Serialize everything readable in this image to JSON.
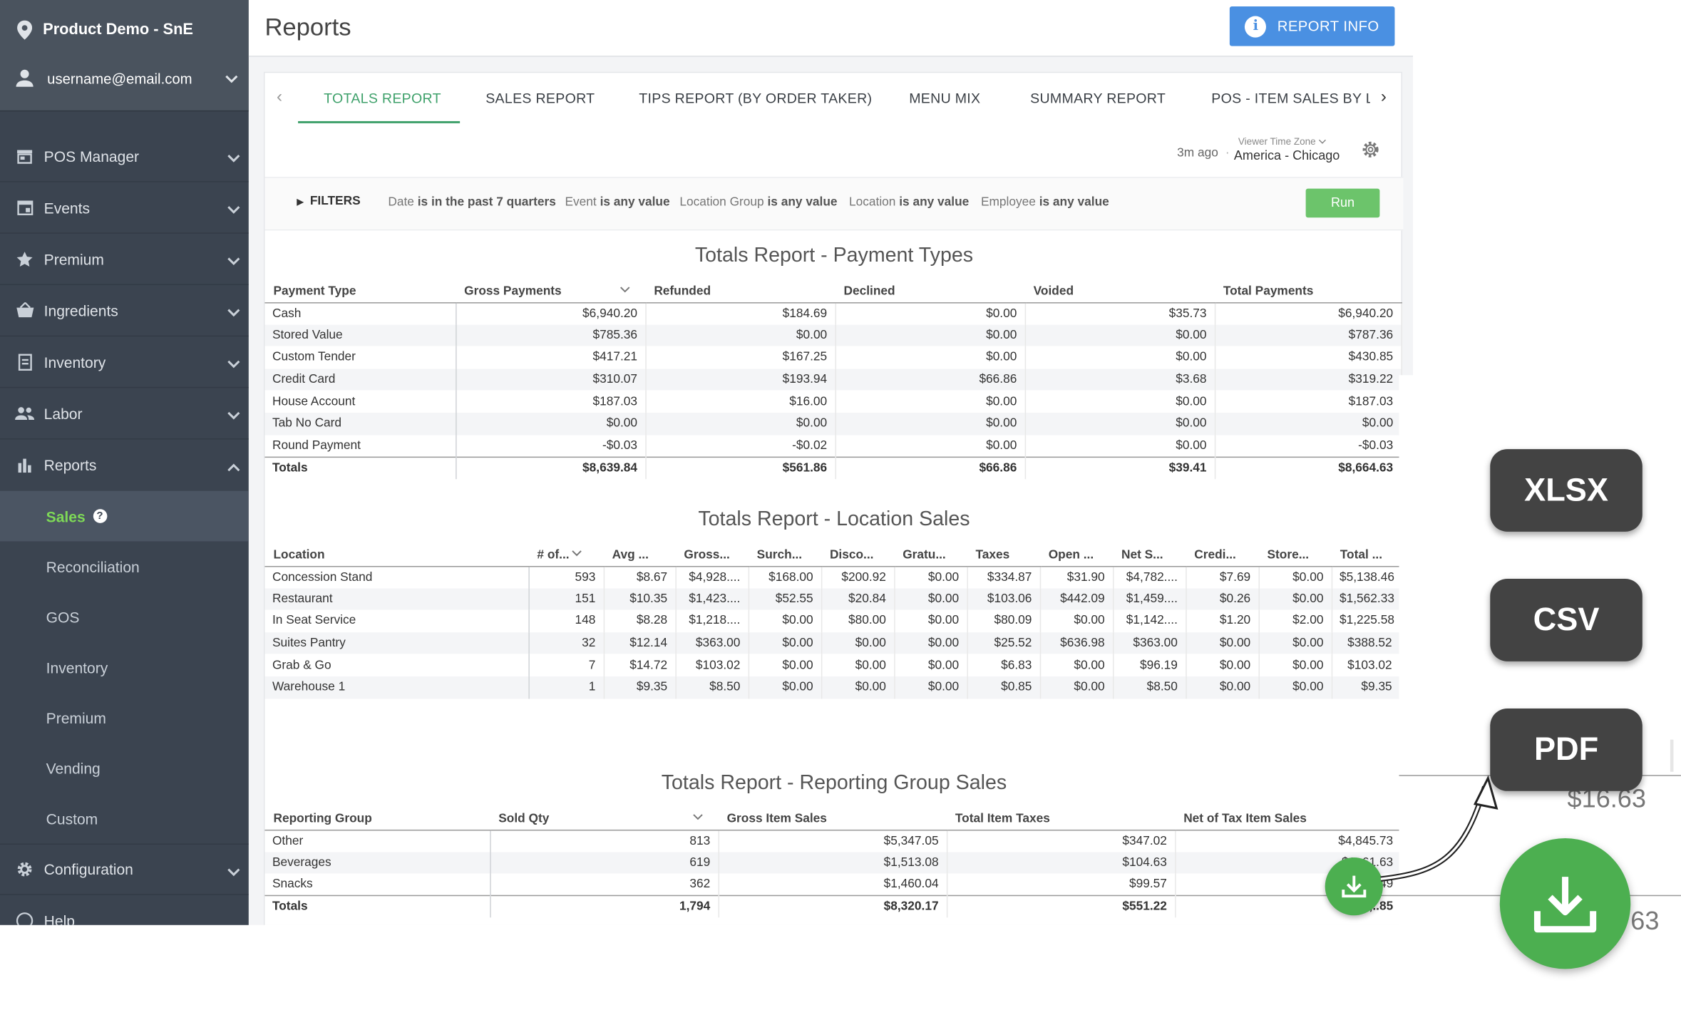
{
  "sidebar": {
    "brand": "Product Demo - SnE",
    "user": "username@email.com",
    "items": [
      {
        "label": "POS Manager"
      },
      {
        "label": "Events"
      },
      {
        "label": "Premium"
      },
      {
        "label": "Ingredients"
      },
      {
        "label": "Inventory"
      },
      {
        "label": "Labor"
      },
      {
        "label": "Reports"
      }
    ],
    "reports_sub": [
      "Sales",
      "Reconciliation",
      "GOS",
      "Inventory",
      "Premium",
      "Vending",
      "Custom"
    ],
    "configuration": "Configuration",
    "help": "Help"
  },
  "header": {
    "title": "Reports",
    "info_button": "REPORT INFO"
  },
  "tabs": [
    "TOTALS REPORT",
    "SALES REPORT",
    "TIPS REPORT (BY ORDER TAKER)",
    "MENU MIX",
    "SUMMARY REPORT",
    "POS - ITEM SALES BY L("
  ],
  "meta": {
    "updated": "3m ago",
    "separator": "·",
    "timezone_label": "Viewer Time Zone",
    "timezone": "America - Chicago"
  },
  "filters": {
    "toggle": "FILTERS",
    "items": [
      {
        "field": "Date",
        "cond": "is in the past 7 quarters"
      },
      {
        "field": "Event",
        "cond": "is any value"
      },
      {
        "field": "Location Group",
        "cond": "is any value"
      },
      {
        "field": "Location",
        "cond": "is any value"
      },
      {
        "field": "Employee",
        "cond": "is any value"
      }
    ],
    "run": "Run"
  },
  "payment_types": {
    "title": "Totals Report - Payment Types",
    "headers": [
      "Payment Type",
      "Gross Payments",
      "Refunded",
      "Declined",
      "Voided",
      "Total Payments"
    ],
    "rows": [
      [
        "Cash",
        "$6,940.20",
        "$184.69",
        "$0.00",
        "$35.73",
        "$6,940.20"
      ],
      [
        "Stored Value",
        "$785.36",
        "$0.00",
        "$0.00",
        "$0.00",
        "$787.36"
      ],
      [
        "Custom Tender",
        "$417.21",
        "$167.25",
        "$0.00",
        "$0.00",
        "$430.85"
      ],
      [
        "Credit Card",
        "$310.07",
        "$193.94",
        "$66.86",
        "$3.68",
        "$319.22"
      ],
      [
        "House Account",
        "$187.03",
        "$16.00",
        "$0.00",
        "$0.00",
        "$187.03"
      ],
      [
        "Tab No Card",
        "$0.00",
        "$0.00",
        "$0.00",
        "$0.00",
        "$0.00"
      ],
      [
        "Round Payment",
        "-$0.03",
        "-$0.02",
        "$0.00",
        "$0.00",
        "-$0.03"
      ]
    ],
    "totals": [
      "Totals",
      "$8,639.84",
      "$561.86",
      "$66.86",
      "$39.41",
      "$8,664.63"
    ]
  },
  "location_sales": {
    "title": "Totals Report - Location Sales",
    "headers": [
      "Location",
      "# of...",
      "Avg ...",
      "Gross...",
      "Surch...",
      "Disco...",
      "Gratu...",
      "Taxes",
      "Open ...",
      "Net S...",
      "Credi...",
      "Store...",
      "Total ..."
    ],
    "rows": [
      [
        "Concession Stand",
        "593",
        "$8.67",
        "$4,928....",
        "$168.00",
        "$200.92",
        "$0.00",
        "$334.87",
        "$31.90",
        "$4,782....",
        "$7.69",
        "$0.00",
        "$5,138.46"
      ],
      [
        "Restaurant",
        "151",
        "$10.35",
        "$1,423....",
        "$52.55",
        "$20.84",
        "$0.00",
        "$103.06",
        "$442.09",
        "$1,459....",
        "$0.26",
        "$0.00",
        "$1,562.33"
      ],
      [
        "In Seat Service",
        "148",
        "$8.28",
        "$1,218....",
        "$0.00",
        "$80.00",
        "$0.00",
        "$80.09",
        "$0.00",
        "$1,142....",
        "$1.20",
        "$2.00",
        "$1,225.58"
      ],
      [
        "Suites Pantry",
        "32",
        "$12.14",
        "$363.00",
        "$0.00",
        "$0.00",
        "$0.00",
        "$25.52",
        "$636.98",
        "$363.00",
        "$0.00",
        "$0.00",
        "$388.52"
      ],
      [
        "Grab & Go",
        "7",
        "$14.72",
        "$103.02",
        "$0.00",
        "$0.00",
        "$0.00",
        "$6.83",
        "$0.00",
        "$96.19",
        "$0.00",
        "$0.00",
        "$103.02"
      ],
      [
        "Warehouse 1",
        "1",
        "$9.35",
        "$8.50",
        "$0.00",
        "$0.00",
        "$0.00",
        "$0.85",
        "$0.00",
        "$8.50",
        "$0.00",
        "$0.00",
        "$9.35"
      ]
    ]
  },
  "reporting_group": {
    "title": "Totals Report - Reporting Group Sales",
    "headers": [
      "Reporting Group",
      "Sold Qty",
      "Gross Item Sales",
      "Total Item Taxes",
      "Net of Tax Item Sales"
    ],
    "rows": [
      [
        "Other",
        "813",
        "$5,347.05",
        "$347.02",
        "$4,845.73"
      ],
      [
        "Beverages",
        "619",
        "$1,513.08",
        "$104.63",
        "$1,.61.63"
      ],
      [
        "Snacks",
        "362",
        "$1,460.04",
        "$99.57",
        "$1,..49"
      ]
    ],
    "totals": [
      "Totals",
      "1,794",
      "$8,320.17",
      "$551.22",
      "$7,..85"
    ]
  },
  "export_menu": {
    "formats": [
      "XLSX",
      "CSV",
      "PDF"
    ],
    "peek_values": [
      "$16.63",
      "63"
    ]
  },
  "colors": {
    "sidebar_bg": "#3b4450",
    "accent_green": "#3fa16b",
    "info_blue": "#4a90e2",
    "run_green": "#6cc46b",
    "download_green": "#4caf50",
    "export_button": "#434343"
  }
}
